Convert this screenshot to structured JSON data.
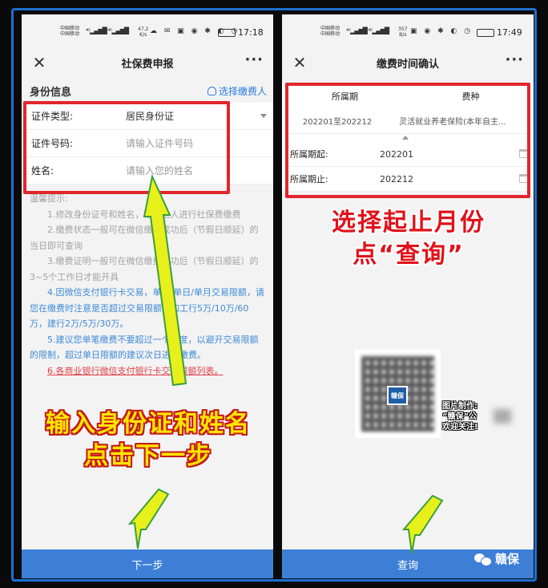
{
  "left_phone": {
    "status": {
      "carrier1": "中国移动",
      "carrier2": "中国移动",
      "speed_value": "47.2",
      "speed_unit": "K/s",
      "battery": "",
      "time": "17:18"
    },
    "title": "社保费申报",
    "section_title": "身份信息",
    "select_payer_label": "选择缴费人",
    "form": {
      "id_type_label": "证件类型:",
      "id_type_value": "居民身份证",
      "id_number_label": "证件号码:",
      "id_number_placeholder": "请输入证件号码",
      "name_label": "姓名:",
      "name_placeholder": "请输入您的姓名"
    },
    "tips": {
      "head": "温馨提示:",
      "t1": "1.修改身份证号和姓名，帮助他人进行社保费缴费",
      "t2": "2.缴费状态一般可在微信缴费成功后（节假日顺延）的当日即可查询",
      "t3": "3.缴费证明一般可在微信缴费成功后（节假日顺延）的3~5个工作日才能开具",
      "t4": "4.因微信支付银行卡交易，单笔/单日/单月交易限额，请您在缴费时注意是否超过交易限额。如工行5万/10万/60万，建行2万/5万/30万。",
      "t5": "5.建议您单笔缴费不要超过一个年度，以避开交易限额的限制，超过单日限额的建议次日进行缴费。",
      "t6": "6.各商业银行微信支付银行卡交易限额列表。"
    },
    "next_button": "下一步",
    "annotation_line1": "输入身份证和姓名",
    "annotation_line2": "点击下一步"
  },
  "right_phone": {
    "status": {
      "carrier1": "中国移动",
      "carrier2": "中国移动",
      "speed_value": "357",
      "speed_unit": "B/s",
      "battery": "",
      "time": "17:49"
    },
    "title": "缴费时间确认",
    "table": {
      "col1": "所属期",
      "col2": "费种",
      "row_period": "202201至202212",
      "row_type": "灵活就业养老保险(本年自主..."
    },
    "start_label": "所属期起:",
    "start_value": "202201",
    "end_label": "所属期止:",
    "end_value": "202212",
    "query_button": "查询",
    "annotation_line1": "选择起止月份",
    "annotation_line2": "点“查询”",
    "qr_logo_text": "赣保",
    "qr_caption_line1": "图片制作:",
    "qr_caption_line2": "“赣保”公",
    "qr_caption_line3": "欢迎关注!"
  },
  "watermark_text": "赣保",
  "colors": {
    "frame": "#1e6fd0",
    "red_box": "#e1262c",
    "button": "#3d7fd6",
    "arrow_fill": "#e8f01c",
    "arrow_stroke": "#3aa03a",
    "annotation_yellow": "#ffe600",
    "annotation_red": "#e0111a"
  }
}
